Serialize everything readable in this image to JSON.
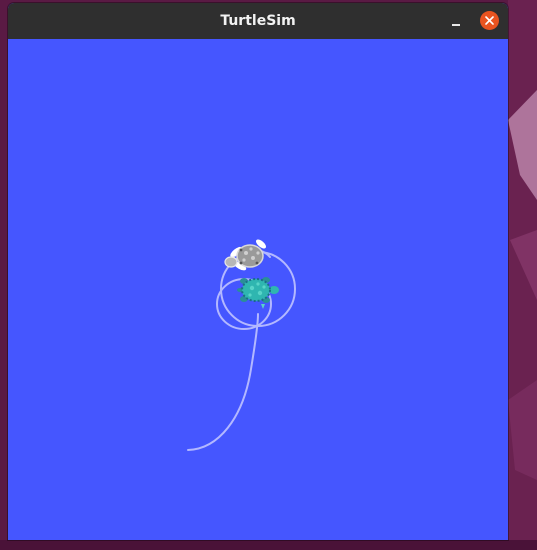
{
  "window": {
    "title": "TurtleSim",
    "minimize_icon": "minimize-icon",
    "close_icon": "close-icon",
    "close_color": "#e95420",
    "titlebar_color": "#2f2f2f"
  },
  "canvas": {
    "background_color": "#4556ff",
    "pen_color": "#b3b8ff",
    "turtles": [
      {
        "icon": "turtle-icon",
        "shell_color": "#9a9a9a"
      },
      {
        "icon": "turtle-icon",
        "shell_color": "#2fb6b0"
      }
    ]
  },
  "desktop": {
    "wallpaper_color": "#5a1a44"
  }
}
